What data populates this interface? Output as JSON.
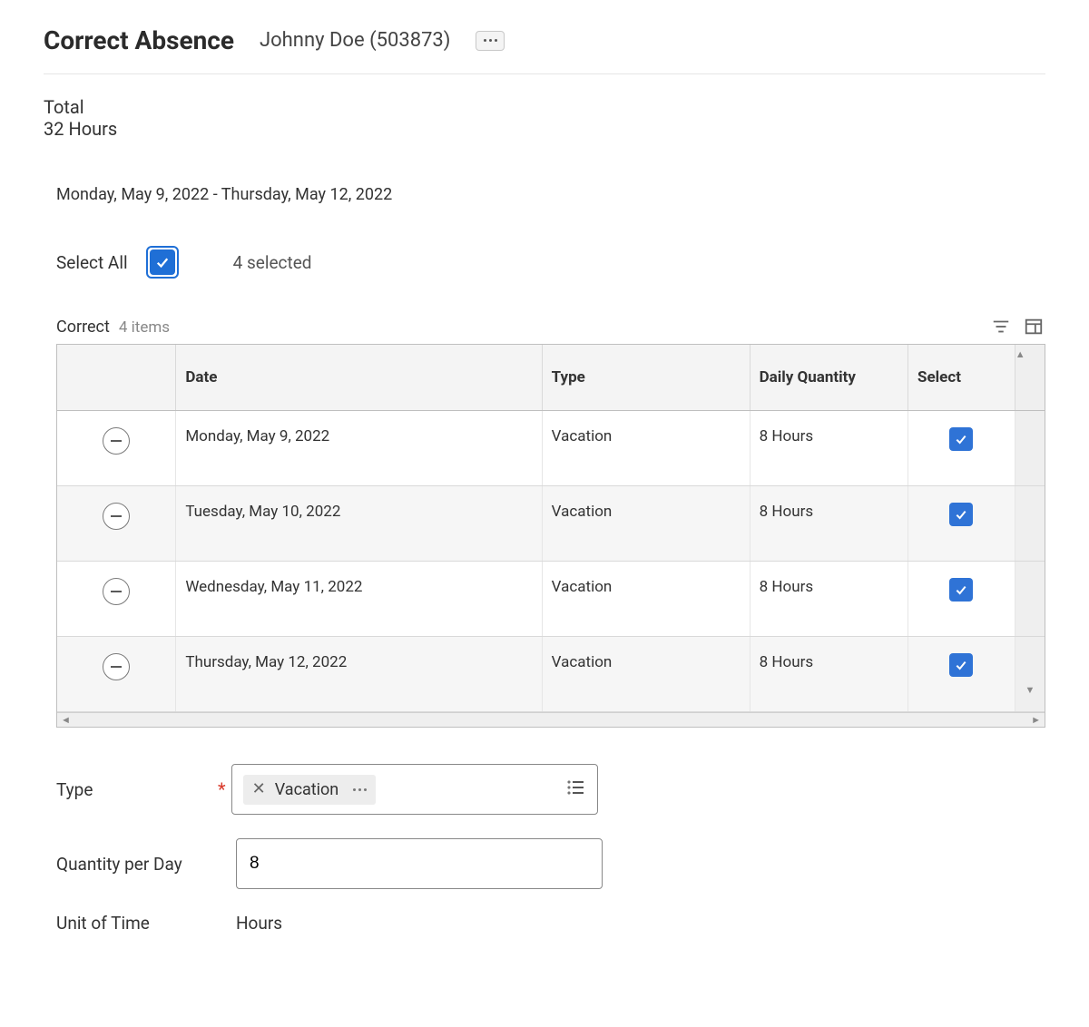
{
  "header": {
    "title": "Correct Absence",
    "subject": "Johnny Doe (503873)"
  },
  "total": {
    "label": "Total",
    "value": "32 Hours"
  },
  "date_range": "Monday, May 9, 2022 - Thursday, May 12, 2022",
  "select_all": {
    "label": "Select All",
    "checked": true,
    "selected_text": "4 selected"
  },
  "table": {
    "name": "Correct",
    "item_count_text": "4 items",
    "columns": {
      "date": "Date",
      "type": "Type",
      "qty": "Daily Quantity",
      "select": "Select"
    },
    "rows": [
      {
        "date": "Monday, May 9, 2022",
        "type": "Vacation",
        "qty": "8 Hours",
        "selected": true
      },
      {
        "date": "Tuesday, May 10, 2022",
        "type": "Vacation",
        "qty": "8 Hours",
        "selected": true
      },
      {
        "date": "Wednesday, May 11, 2022",
        "type": "Vacation",
        "qty": "8 Hours",
        "selected": true
      },
      {
        "date": "Thursday, May 12, 2022",
        "type": "Vacation",
        "qty": "8 Hours",
        "selected": true
      }
    ]
  },
  "form": {
    "type_label": "Type",
    "type_value": "Vacation",
    "qty_label": "Quantity per Day",
    "qty_value": "8",
    "unit_label": "Unit of Time",
    "unit_value": "Hours"
  }
}
